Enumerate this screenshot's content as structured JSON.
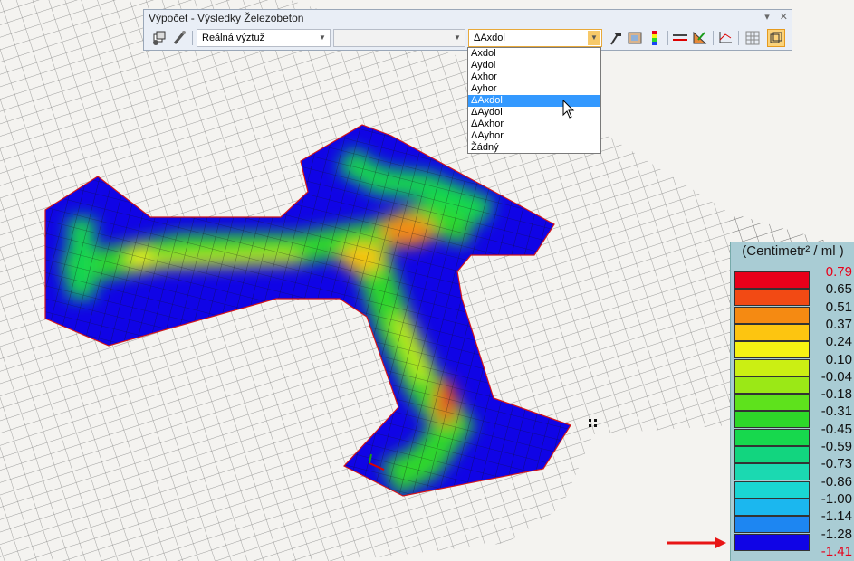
{
  "toolbar": {
    "title": "Výpočet - Výsledky Železobeton",
    "pin_glyph": "▾",
    "close_glyph": "✕",
    "combo1": "Reálná výztuž",
    "combo2": "",
    "combo3": "ΔAxdol"
  },
  "dropdown": {
    "options": [
      "Axdol",
      "Aydol",
      "Axhor",
      "Ayhor",
      "ΔAxdol",
      "ΔAydol",
      "ΔAxhor",
      "ΔAyhor",
      "Žádný"
    ],
    "selected_index": 4
  },
  "legend": {
    "unit": "(Centimetr² / ml )",
    "labels": [
      "0.79",
      "0.65",
      "0.51",
      "0.37",
      "0.24",
      "0.10",
      "-0.04",
      "-0.18",
      "-0.31",
      "-0.45",
      "-0.59",
      "-0.73",
      "-0.86",
      "-1.00",
      "-1.14",
      "-1.28",
      "-1.41"
    ],
    "colors": [
      "#e8001a",
      "#f24a14",
      "#f58a12",
      "#fdc510",
      "#f6f312",
      "#cbef13",
      "#9be816",
      "#5ee21c",
      "#2ed829",
      "#17d84d",
      "#12d57f",
      "#1bd9b1",
      "#1ad6d3",
      "#1bb7ef",
      "#1d86f2",
      "#1a45f4",
      "#1004e6"
    ],
    "extreme_color": "#e8001a"
  },
  "icons": {
    "toolbar": [
      "results-icon",
      "pick-icon",
      "hammer-icon",
      "panel-icon",
      "color-scale-icon",
      "sections-icon",
      "diagram-icon",
      "axes-icon",
      "grid-icon",
      "sync-icon"
    ],
    "legend_marker": "red-arrow-icon"
  }
}
